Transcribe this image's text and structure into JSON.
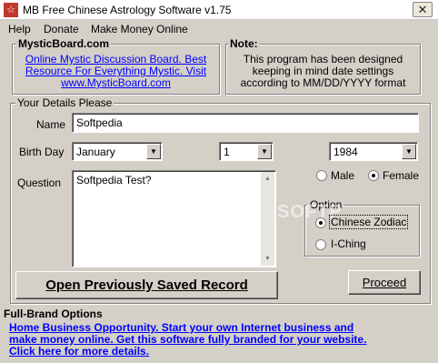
{
  "window": {
    "title": "MB Free Chinese Astrology Software v1.75",
    "app_icon_glyph": "☆",
    "close_glyph": "✕"
  },
  "menu": [
    "Help",
    "Donate",
    "Make Money Online"
  ],
  "promo": {
    "title": "MysticBoard.com",
    "line1": "Online Mystic Discussion Board. Best",
    "line2": "Resource For Everything Mystic. Visit",
    "line3": "www.MysticBoard.com"
  },
  "note": {
    "title": "Note:",
    "line1": "This program has been designed",
    "line2": "keeping in mind date settings",
    "line3": "according to MM/DD/YYYY format"
  },
  "details": {
    "group_title": "Your Details Please",
    "name_label": "Name",
    "name_value": "Softpedia",
    "birthday_label": "Birth Day",
    "month": "January",
    "day": "1",
    "year": "1984",
    "question_label": "Question",
    "question_value": "Softpedia Test?",
    "gender_male": "Male",
    "gender_female": "Female",
    "gender_selected": "Female",
    "option_title": "Option",
    "option_chinese": "Chinese Zodiac",
    "option_iching": "I-Ching",
    "option_selected": "Chinese Zodiac",
    "open_button": "Open Previously Saved Record",
    "proceed_button": "Proceed"
  },
  "fullbrand": {
    "title": "Full-Brand Options",
    "line1": "Home Business Opportunity. Start your own Internet business and",
    "line2": "make money online. Get this software fully branded for your website.",
    "line3": "Click here for more details."
  },
  "watermark": "SOFTP",
  "colors": {
    "link": "#0000ff",
    "window_bg": "#d4d0c8",
    "title_icon": "#c0392b"
  }
}
